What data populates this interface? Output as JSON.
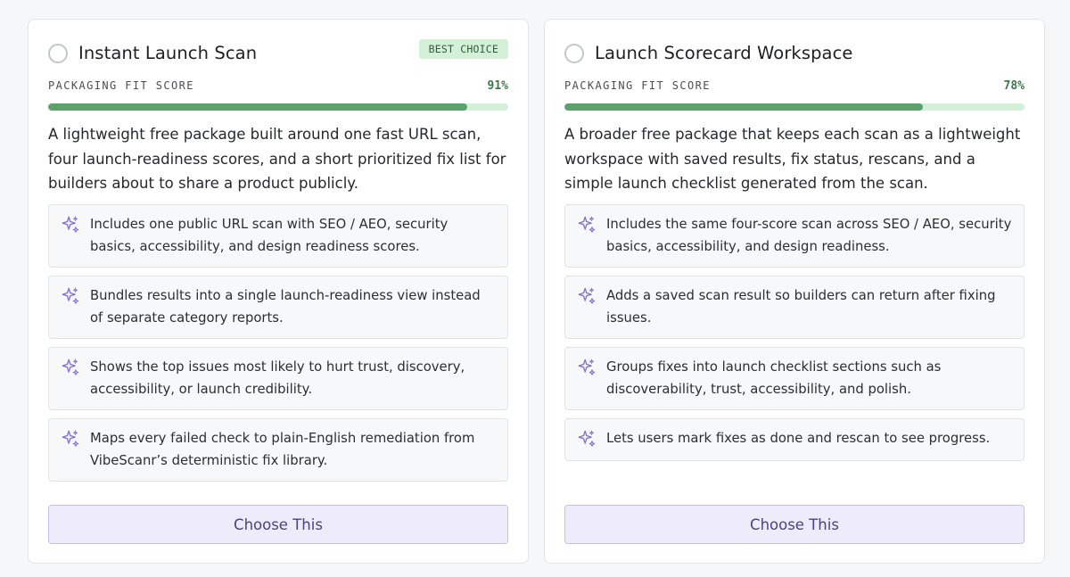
{
  "colors": {
    "accent_purple": "#8b6fd6",
    "score_green": "#5aa26a",
    "score_track": "#d3f0d9",
    "badge_bg": "#d5f0d8",
    "button_bg": "#eeebfb"
  },
  "cards": [
    {
      "title": "Instant Launch Scan",
      "badge": "BEST CHOICE",
      "fit_label": "PACKAGING FIT SCORE",
      "fit_value": "91%",
      "fit_fraction": 0.91,
      "description": "A lightweight free package built around one fast URL scan, four launch-readiness scores, and a short prioritized fix list for builders about to share a product publicly.",
      "features": [
        {
          "icon": "sparkle-icon",
          "text": "Includes one public URL scan with SEO / AEO, security basics, accessibility, and design readiness scores."
        },
        {
          "icon": "sparkle-icon",
          "text": "Bundles results into a single launch-readiness view instead of separate category reports."
        },
        {
          "icon": "sparkle-icon",
          "text": "Shows the top issues most likely to hurt trust, discovery, accessibility, or launch credibility."
        },
        {
          "icon": "sparkle-icon",
          "text": "Maps every failed check to plain-English remediation from VibeScanr’s deterministic fix library."
        }
      ],
      "button_label": "Choose This"
    },
    {
      "title": "Launch Scorecard Workspace",
      "badge": "",
      "fit_label": "PACKAGING FIT SCORE",
      "fit_value": "78%",
      "fit_fraction": 0.78,
      "description": "A broader free package that keeps each scan as a lightweight workspace with saved results, fix status, rescans, and a simple launch checklist generated from the scan.",
      "features": [
        {
          "icon": "sparkle-icon",
          "text": "Includes the same four-score scan across SEO / AEO, security basics, accessibility, and design readiness."
        },
        {
          "icon": "sparkle-icon",
          "text": "Adds a saved scan result so builders can return after fixing issues."
        },
        {
          "icon": "sparkle-icon",
          "text": "Groups fixes into launch checklist sections such as discoverability, trust, accessibility, and polish."
        },
        {
          "icon": "sparkle-icon",
          "text": "Lets users mark fixes as done and rescan to see progress."
        }
      ],
      "button_label": "Choose This"
    }
  ]
}
